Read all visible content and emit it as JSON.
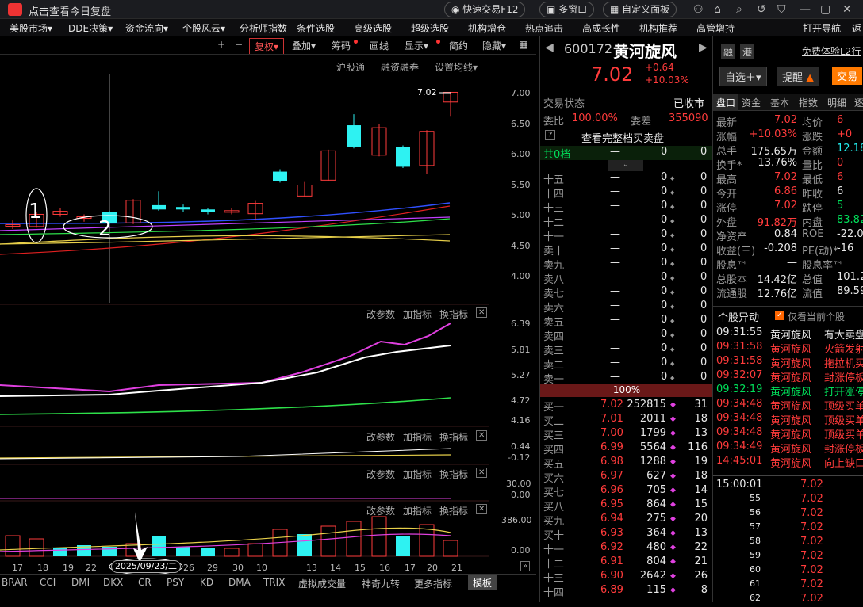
{
  "titlebar": {
    "title": "点击查看今日复盘",
    "quick_trade": "快速交易F12",
    "multi_window": "多窗口",
    "custom_panel": "自定义面板"
  },
  "menu": [
    "美股市场▾",
    "DDE决策▾",
    "资金流向▾",
    "个股风云▾",
    "分析师指数",
    "条件选股",
    "高级选股",
    "超级选股",
    "机构增仓",
    "热点追击",
    "高成长性",
    "机构推荐",
    "高管增持",
    "打开导航",
    "返"
  ],
  "toolbar": {
    "plus": "+",
    "minus": "−",
    "fq": "复权▾",
    "overlay": "叠加▾",
    "chips": "筹码",
    "draw": "画线",
    "display": "显示▾",
    "simple": "简约",
    "hide": "隐藏▾"
  },
  "subtoolbar": [
    "沪股通",
    "融资融券",
    "设置均线▾"
  ],
  "price_axis": [
    "7.00",
    "6.50",
    "6.00",
    "5.50",
    "5.00",
    "4.50",
    "4.00"
  ],
  "last_price_label": "7.02",
  "annot": {
    "one": "1",
    "two": "2"
  },
  "panel_btns": {
    "p": "改参数",
    "a": "加指标",
    "s": "换指标",
    "x": "✕"
  },
  "p2_axis": [
    "6.39",
    "5.81",
    "5.27",
    "4.72",
    "4.16"
  ],
  "p3_axis": [
    "0.44",
    "-0.12"
  ],
  "p4_axis": [
    "30.00",
    "0.00"
  ],
  "p5_axis": [
    "386.00",
    "0.00"
  ],
  "x_dates": [
    "17",
    "18",
    "19",
    "22",
    "",
    "26",
    "29",
    "30",
    "10",
    "13",
    "14",
    "15",
    "16",
    "17",
    "20",
    "21"
  ],
  "x_cursor_date": "2025/09/23/二",
  "bottom_tabs": [
    "BRAR",
    "CCI",
    "DMI",
    "DKX",
    "CR",
    "PSY",
    "KD",
    "DMA",
    "TRIX",
    "虚拟成交量",
    "神奇九转",
    "更多指标",
    "模板"
  ],
  "stock": {
    "code": "600172",
    "name": "黄河旋风",
    "price": "7.02",
    "change": "+0.64",
    "pct": "+10.03%",
    "tag1": "融",
    "tag2": "港",
    "trial": "免费体验L2行",
    "add": "自选＋▾",
    "remind": "提醒",
    "trade": "交易"
  },
  "trade_status": {
    "label": "交易状态",
    "value": "已收市"
  },
  "weibi": {
    "l1": "委比",
    "v1": "100.00%",
    "l2": "委差",
    "v2": "355090"
  },
  "view_full": "查看完整档买卖盘",
  "total_levels": {
    "label": "共0档",
    "d": "—",
    "n": "0",
    "m": "0"
  },
  "upper_levels": [
    "十五",
    "十四",
    "十三",
    "十二",
    "十一",
    "卖十",
    "卖九",
    "卖八",
    "卖七",
    "卖六",
    "卖五",
    "卖四",
    "卖三",
    "卖二",
    "卖一"
  ],
  "bar_pct": "100%",
  "buys": [
    {
      "l": "买一",
      "p": "7.02",
      "v": "252815",
      "n": "31"
    },
    {
      "l": "买二",
      "p": "7.01",
      "v": "2011",
      "n": "18"
    },
    {
      "l": "买三",
      "p": "7.00",
      "v": "1799",
      "n": "13"
    },
    {
      "l": "买四",
      "p": "6.99",
      "v": "5564",
      "n": "116"
    },
    {
      "l": "买五",
      "p": "6.98",
      "v": "1288",
      "n": "19"
    },
    {
      "l": "买六",
      "p": "6.97",
      "v": "627",
      "n": "18"
    },
    {
      "l": "买七",
      "p": "6.96",
      "v": "705",
      "n": "14"
    },
    {
      "l": "买八",
      "p": "6.95",
      "v": "864",
      "n": "15"
    },
    {
      "l": "买九",
      "p": "6.94",
      "v": "275",
      "n": "20"
    },
    {
      "l": "买十",
      "p": "6.93",
      "v": "364",
      "n": "13"
    },
    {
      "l": "十一",
      "p": "6.92",
      "v": "480",
      "n": "22"
    },
    {
      "l": "十二",
      "p": "6.91",
      "v": "804",
      "n": "21"
    },
    {
      "l": "十三",
      "p": "6.90",
      "v": "2642",
      "n": "26"
    },
    {
      "l": "十四",
      "p": "6.89",
      "v": "115",
      "n": "8"
    }
  ],
  "tabs": [
    "盘口",
    "资金",
    "基本",
    "指数",
    "明细",
    "逐"
  ],
  "quote": [
    {
      "a": "最新",
      "b": "7.02",
      "c": "均价",
      "d": "6",
      "bc": "red"
    },
    {
      "a": "涨幅",
      "b": "+10.03%",
      "c": "涨跌",
      "d": "+0",
      "bc": "red"
    },
    {
      "a": "总手",
      "b": "175.65万",
      "c": "金额",
      "d": "12.18",
      "bc": "wht",
      "dc": "cyan"
    },
    {
      "a": "换手*",
      "b": "13.76%",
      "c": "量比",
      "d": "0",
      "bc": "wht"
    },
    {
      "a": "最高",
      "b": "7.02",
      "c": "最低",
      "d": "6",
      "bc": "red"
    },
    {
      "a": "今开",
      "b": "6.86",
      "c": "昨收",
      "d": "6",
      "bc": "red",
      "dc": "wht"
    },
    {
      "a": "涨停",
      "b": "7.02",
      "c": "跌停",
      "d": "5",
      "bc": "red",
      "dc": "grn"
    },
    {
      "a": "外盘",
      "b": "91.82万",
      "c": "内盘",
      "d": "83.82",
      "bc": "red",
      "dc": "grn"
    },
    {
      "a": "净资产",
      "b": "0.84",
      "c": "ROE",
      "d": "-22.0",
      "bc": "wht",
      "dc": "wht"
    },
    {
      "a": "收益(三)",
      "b": "-0.208",
      "c": "PE(动)*",
      "d": "-16",
      "bc": "wht",
      "dc": "wht"
    },
    {
      "a": "股息™",
      "b": "—",
      "c": "股息率™",
      "d": "",
      "bc": "wht",
      "dc": "wht"
    },
    {
      "a": "总股本",
      "b": "14.42亿",
      "c": "总值",
      "d": "101.2",
      "bc": "wht",
      "dc": "wht"
    },
    {
      "a": "流通股",
      "b": "12.76亿",
      "c": "流值",
      "d": "89.59",
      "bc": "wht",
      "dc": "wht"
    }
  ],
  "movers": {
    "title": "个股异动",
    "only": "仅看当前个股",
    "rows": [
      {
        "t": "09:31:55",
        "n": "黄河旋风",
        "e": "有大卖盘",
        "c": "wht"
      },
      {
        "t": "09:31:58",
        "n": "黄河旋风",
        "e": "火箭发射",
        "c": "red"
      },
      {
        "t": "09:31:58",
        "n": "黄河旋风",
        "e": "拖拉机买",
        "c": "red"
      },
      {
        "t": "09:32:07",
        "n": "黄河旋风",
        "e": "封涨停板",
        "c": "red"
      },
      {
        "t": "09:32:19",
        "n": "黄河旋风",
        "e": "打开涨停",
        "c": "grn"
      },
      {
        "t": "09:34:48",
        "n": "黄河旋风",
        "e": "顶级买单",
        "c": "red"
      },
      {
        "t": "09:34:48",
        "n": "黄河旋风",
        "e": "顶级买单",
        "c": "red"
      },
      {
        "t": "09:34:48",
        "n": "黄河旋风",
        "e": "顶级买单",
        "c": "red"
      },
      {
        "t": "09:34:49",
        "n": "黄河旋风",
        "e": "封涨停板",
        "c": "red"
      },
      {
        "t": "14:45:01",
        "n": "黄河旋风",
        "e": "向上缺口",
        "c": "red"
      }
    ]
  },
  "ticks": [
    {
      "t": "15:00:01",
      "p": "7.02"
    },
    {
      "t": "55",
      "p": "7.02"
    },
    {
      "t": "56",
      "p": "7.02"
    },
    {
      "t": "57",
      "p": "7.02"
    },
    {
      "t": "58",
      "p": "7.02"
    },
    {
      "t": "59",
      "p": "7.02"
    },
    {
      "t": "60",
      "p": "7.02"
    },
    {
      "t": "61",
      "p": "7.02"
    },
    {
      "t": "62",
      "p": "7.02"
    }
  ],
  "candles": [
    {
      "d": "",
      "o": 4.83,
      "c": 4.85,
      "h": 4.92,
      "l": 4.78
    },
    {
      "d": "17",
      "o": 4.82,
      "c": 5.02,
      "h": 5.06,
      "l": 4.8
    },
    {
      "d": "18",
      "o": 5.02,
      "c": 5.07,
      "h": 5.12,
      "l": 4.98
    },
    {
      "d": "19",
      "o": 4.96,
      "c": 4.98,
      "h": 5.02,
      "l": 4.9
    },
    {
      "d": "23",
      "o": 5.06,
      "c": 4.88,
      "h": 5.08,
      "l": 4.86
    },
    {
      "d": "",
      "o": 4.88,
      "c": 5.25,
      "h": 5.27,
      "l": 4.86
    },
    {
      "d": "26",
      "o": 5.17,
      "c": 5.1,
      "h": 5.4,
      "l": 5.08
    },
    {
      "d": "29",
      "o": 5.14,
      "c": 5.1,
      "h": 5.18,
      "l": 5.06
    },
    {
      "d": "30",
      "o": 5.1,
      "c": 5.06,
      "h": 5.12,
      "l": 5.02
    },
    {
      "d": "",
      "o": 5.06,
      "c": 5.08,
      "h": 5.12,
      "l": 5.02
    },
    {
      "d": "10",
      "o": 5.03,
      "c": 5.2,
      "h": 5.24,
      "l": 4.92
    },
    {
      "d": "13",
      "o": 5.72,
      "c": 5.56,
      "h": 5.76,
      "l": 5.54
    },
    {
      "d": "14",
      "o": 5.32,
      "c": 5.5,
      "h": 5.55,
      "l": 5.3
    },
    {
      "d": "15",
      "o": 5.58,
      "c": 6.06,
      "h": 6.08,
      "l": 5.56
    },
    {
      "d": "16",
      "o": 6.48,
      "c": 6.13,
      "h": 6.66,
      "l": 6.1
    },
    {
      "d": "17",
      "o": 5.99,
      "c": 6.44,
      "h": 6.5,
      "l": 5.97
    },
    {
      "d": "20",
      "o": 6.13,
      "c": 5.8,
      "h": 6.15,
      "l": 5.78
    },
    {
      "d": "21",
      "o": 5.82,
      "c": 6.38,
      "h": 6.4,
      "l": 5.68
    },
    {
      "d": "22",
      "o": 6.86,
      "c": 7.02,
      "h": 7.02,
      "l": 6.62
    }
  ]
}
